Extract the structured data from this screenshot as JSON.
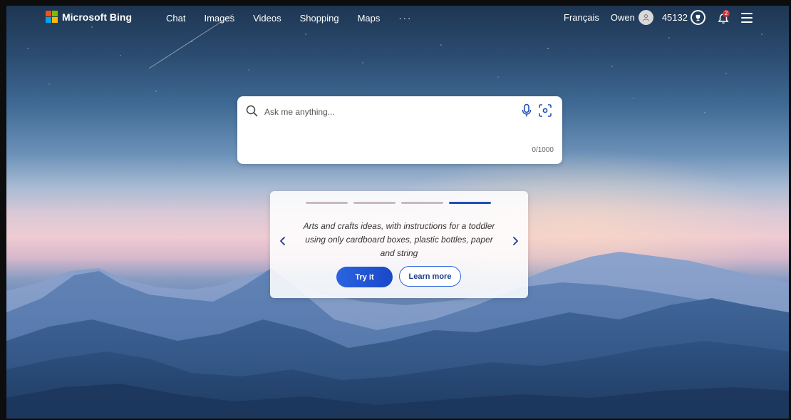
{
  "header": {
    "brand": "Microsoft Bing",
    "nav": [
      {
        "label": "Chat"
      },
      {
        "label": "Images"
      },
      {
        "label": "Videos"
      },
      {
        "label": "Shopping"
      },
      {
        "label": "Maps"
      }
    ],
    "more": "···",
    "language": "Français",
    "user_name": "Owen",
    "points": "45132",
    "notification_count": "2"
  },
  "search": {
    "placeholder": "Ask me anything...",
    "value": "",
    "counter": "0/1000"
  },
  "suggestion": {
    "text": "Arts and crafts ideas, with instructions for a toddler using only cardboard boxes, plastic bottles, paper and string",
    "try_label": "Try it",
    "learn_label": "Learn more",
    "total_slides": 4,
    "active_slide": 4
  },
  "colors": {
    "accent": "#1f4fb6",
    "logo_red": "#f25022",
    "logo_green": "#7fba00",
    "logo_blue": "#00a4ef",
    "logo_yellow": "#ffb900",
    "badge": "#d13438"
  },
  "icons": [
    "windows-logo-icon",
    "search-icon",
    "mic-icon",
    "visual-search-icon",
    "avatar-icon",
    "trophy-icon",
    "bell-icon",
    "hamburger-icon",
    "chevron-left-icon",
    "chevron-right-icon"
  ]
}
